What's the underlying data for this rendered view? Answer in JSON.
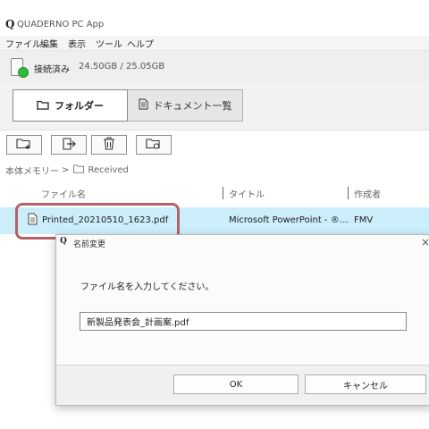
{
  "app": {
    "logo": "Q",
    "title": "QUADERNO PC App"
  },
  "menu": [
    {
      "label": "ファイル"
    },
    {
      "label": "編集"
    },
    {
      "label": "表示"
    },
    {
      "label": "ツール"
    },
    {
      "label": "ヘルプ"
    }
  ],
  "device": {
    "status": "接続済み",
    "storage": "24.50GB / 25.05GB",
    "status_color": "#2dbd3c"
  },
  "tabs": {
    "folder": "フォルダー",
    "documents": "ドキュメント一覧"
  },
  "toolbar": {
    "icons": [
      "new-folder-icon",
      "move-out-icon",
      "trash-icon",
      "sync-folder-icon"
    ]
  },
  "breadcrumb": {
    "root": "本体メモリー",
    "separator": ">",
    "current": "Received"
  },
  "file_list": {
    "columns": [
      "ファイル名",
      "タイトル",
      "作成者"
    ],
    "rows": [
      {
        "name": "Printed_20210510_1623.pdf",
        "title": "Microsoft PowerPoint - ®…",
        "author": "FMV"
      }
    ],
    "selected_color": "#cbeefa",
    "highlight_color": "#b5616a"
  },
  "dialog": {
    "logo": "Q",
    "title": "名前変更",
    "close": "×",
    "prompt": "ファイル名を入力してください。",
    "input_value": "新製品発表会_計画案.pdf",
    "ok_label": "OK",
    "cancel_label": "キャンセル"
  }
}
